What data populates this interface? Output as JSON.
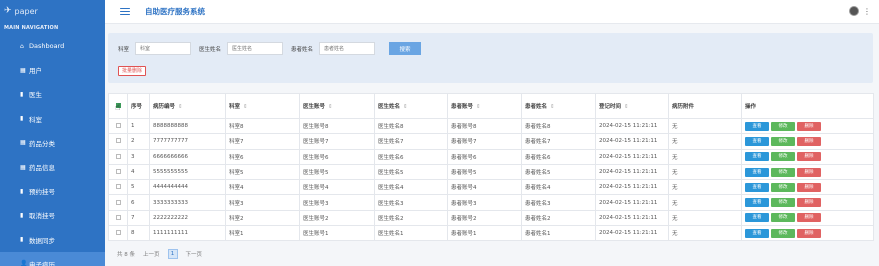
{
  "sidebar": {
    "logo": "paper",
    "section": "MAIN NAVIGATION",
    "items": [
      {
        "icon": "⌂",
        "label": "Dashboard"
      },
      {
        "icon": "▦",
        "label": "用户"
      },
      {
        "icon": "▮",
        "label": "医生"
      },
      {
        "icon": "▮",
        "label": "科室"
      },
      {
        "icon": "▦",
        "label": "药品分类"
      },
      {
        "icon": "▦",
        "label": "药品信息"
      },
      {
        "icon": "▮",
        "label": "预约挂号"
      },
      {
        "icon": "▮",
        "label": "取消挂号"
      },
      {
        "icon": "▮",
        "label": "数据同步"
      },
      {
        "icon": "👤",
        "label": "电子病历"
      }
    ]
  },
  "topbar": {
    "title": "自助医疗服务系统"
  },
  "search": {
    "dept_label": "科室",
    "dept_placeholder": "科室",
    "doctor_label": "医生姓名",
    "doctor_placeholder": "医生姓名",
    "patient_label": "患者姓名",
    "patient_placeholder": "患者姓名",
    "search_btn": "搜索",
    "batch_delete": "批量删除"
  },
  "table": {
    "headers": [
      "序号",
      "病历编号",
      "科室",
      "医生账号",
      "医生姓名",
      "患者账号",
      "患者姓名",
      "登记时间",
      "病历附件",
      "操作"
    ],
    "rows": [
      {
        "no": "1",
        "id": "8888888888",
        "dept": "科室8",
        "doc_acc": "医生账号8",
        "doc_name": "医生姓名8",
        "pat_acc": "患者账号8",
        "pat_name": "患者姓名8",
        "time": "2024-02-15 11:21:11",
        "attach": "无"
      },
      {
        "no": "2",
        "id": "7777777777",
        "dept": "科室7",
        "doc_acc": "医生账号7",
        "doc_name": "医生姓名7",
        "pat_acc": "患者账号7",
        "pat_name": "患者姓名7",
        "time": "2024-02-15 11:21:11",
        "attach": "无"
      },
      {
        "no": "3",
        "id": "6666666666",
        "dept": "科室6",
        "doc_acc": "医生账号6",
        "doc_name": "医生姓名6",
        "pat_acc": "患者账号6",
        "pat_name": "患者姓名6",
        "time": "2024-02-15 11:21:11",
        "attach": "无"
      },
      {
        "no": "4",
        "id": "5555555555",
        "dept": "科室5",
        "doc_acc": "医生账号5",
        "doc_name": "医生姓名5",
        "pat_acc": "患者账号5",
        "pat_name": "患者姓名5",
        "time": "2024-02-15 11:21:11",
        "attach": "无"
      },
      {
        "no": "5",
        "id": "4444444444",
        "dept": "科室4",
        "doc_acc": "医生账号4",
        "doc_name": "医生姓名4",
        "pat_acc": "患者账号4",
        "pat_name": "患者姓名4",
        "time": "2024-02-15 11:21:11",
        "attach": "无"
      },
      {
        "no": "6",
        "id": "3333333333",
        "dept": "科室3",
        "doc_acc": "医生账号3",
        "doc_name": "医生姓名3",
        "pat_acc": "患者账号3",
        "pat_name": "患者姓名3",
        "time": "2024-02-15 11:21:11",
        "attach": "无"
      },
      {
        "no": "7",
        "id": "2222222222",
        "dept": "科室2",
        "doc_acc": "医生账号2",
        "doc_name": "医生姓名2",
        "pat_acc": "患者账号2",
        "pat_name": "患者姓名2",
        "time": "2024-02-15 11:21:11",
        "attach": "无"
      },
      {
        "no": "8",
        "id": "1111111111",
        "dept": "科室1",
        "doc_acc": "医生账号1",
        "doc_name": "医生姓名1",
        "pat_acc": "患者账号1",
        "pat_name": "患者姓名1",
        "time": "2024-02-15 11:21:11",
        "attach": "无"
      }
    ],
    "actions": {
      "view": "查看",
      "edit": "修改",
      "delete": "删除"
    }
  },
  "pager": {
    "total": "共 8 条",
    "prev": "上一页",
    "page": "1",
    "next": "下一页"
  },
  "colors": {
    "sidebar": "#2e73c4",
    "active": "#4a8ad6",
    "view": "#2b97d9",
    "edit": "#5cb85c",
    "delete": "#e06262"
  }
}
